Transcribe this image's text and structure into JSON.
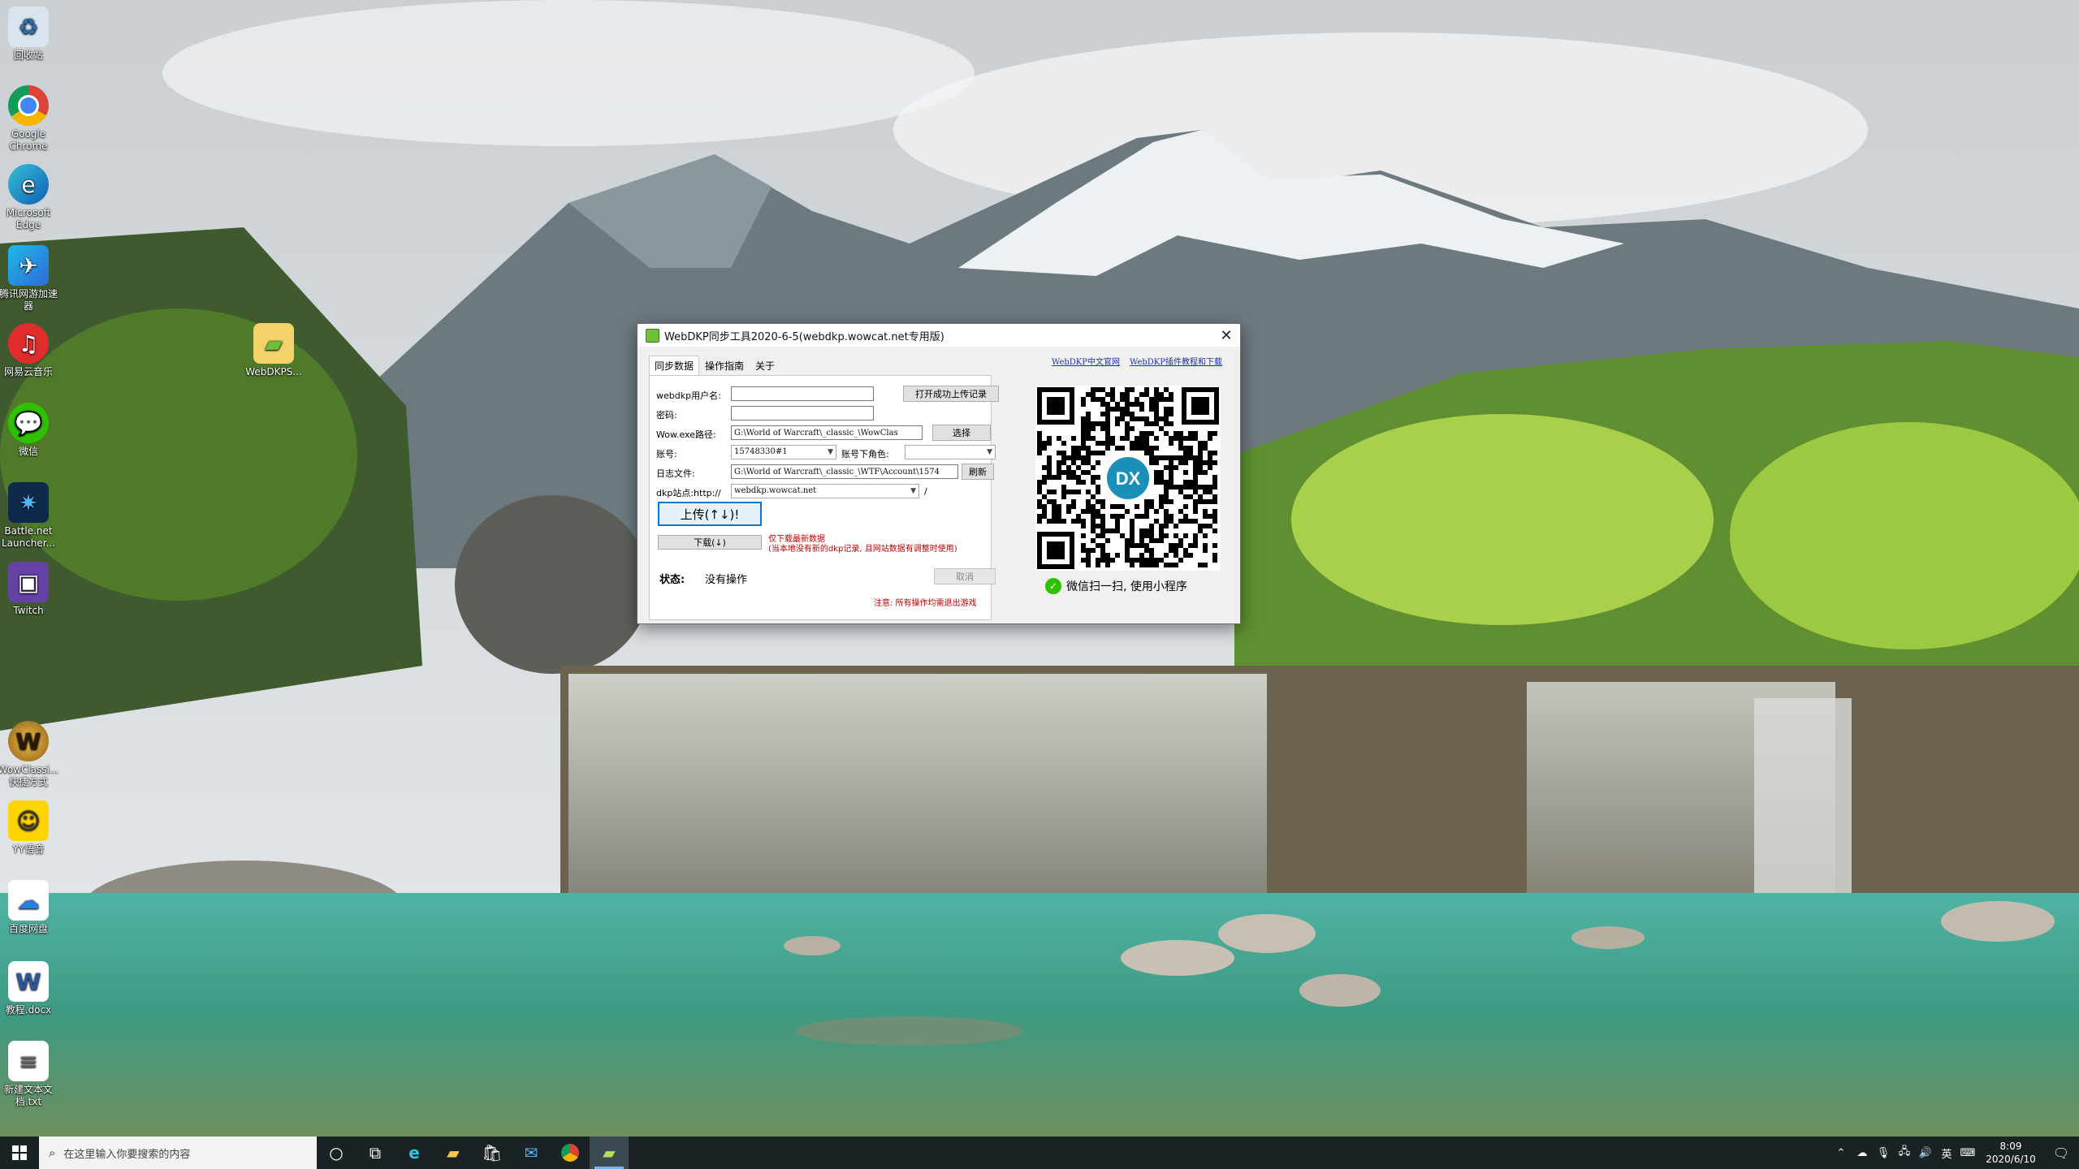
{
  "desktop": {
    "icons": [
      {
        "label": "回收站",
        "icon": "recycle-bin-icon"
      },
      {
        "label": "Google Chrome",
        "icon": "chrome-icon"
      },
      {
        "label": "Microsoft Edge",
        "icon": "edge-icon"
      },
      {
        "label": "腾讯网游加速器",
        "icon": "tencent-accelerator-icon"
      },
      {
        "label": "网易云音乐",
        "icon": "netease-music-icon"
      },
      {
        "label": "微信",
        "icon": "wechat-icon"
      },
      {
        "label": "Battle.net Launcher...",
        "icon": "battlenet-icon"
      },
      {
        "label": "Twitch",
        "icon": "twitch-icon"
      },
      {
        "label": "WowClassi... 快捷方式",
        "icon": "wow-icon"
      },
      {
        "label": "YY语音",
        "icon": "yy-icon"
      },
      {
        "label": "百度网盘",
        "icon": "baidu-netdisk-icon"
      },
      {
        "label": "教程.docx",
        "icon": "word-document-icon"
      },
      {
        "label": "新建文本文档.txt",
        "icon": "text-file-icon"
      },
      {
        "label": "WebDKPS...",
        "icon": "folder-icon"
      }
    ]
  },
  "dialog": {
    "title": "WebDKP同步工具2020-6-5(webdkp.wowcat.net专用版)",
    "tabs": [
      "同步数据",
      "操作指南",
      "关于"
    ],
    "fields": {
      "username_label": "webdkp用户名:",
      "username_value": "",
      "password_label": "密码:",
      "password_value": "",
      "wow_path_label": "Wow.exe路径:",
      "wow_path_value": "G:\\World of Warcraft\\_classic_\\WowClas",
      "account_label": "账号:",
      "account_value": "15748330#1",
      "character_label": "账号下角色:",
      "character_value": "",
      "log_label": "日志文件:",
      "log_value": "G:\\World of Warcraft\\_classic_\\WTF\\Account\\1574",
      "site_label": "dkp站点:http://",
      "site_value": "webdkp.wowcat.net",
      "site_suffix": "/"
    },
    "buttons": {
      "open_log": "打开成功上传记录",
      "choose": "选择",
      "refresh": "刷新",
      "upload": "上传(↑↓)!",
      "download": "下载(↓)",
      "cancel": "取消"
    },
    "download_note_1": "仅下载最新数据",
    "download_note_2": "(当本地没有新的dkp记录, 且网站数据有调整时使用)",
    "status_label": "状态:",
    "status_value": "没有操作",
    "warning": "注意: 所有操作均需退出游戏",
    "links": [
      "WebDKP中文官网",
      "WebDKP插件教程和下载"
    ],
    "qr_center_text": "DX",
    "wechat_text": "微信扫一扫, 使用小程序",
    "colors": {
      "warning": "#c00000",
      "note": "#c00000",
      "link": "#1a2fbf",
      "accent": "#0078d7"
    }
  },
  "taskbar": {
    "search_placeholder": "在这里输入你要搜索的内容",
    "time": "8:09",
    "date": "2020/6/10",
    "ime": "英",
    "apps": [
      "task-view-icon",
      "edge-icon",
      "file-explorer-icon",
      "store-icon",
      "mail-icon",
      "chrome-icon",
      "webdkp-icon"
    ]
  }
}
